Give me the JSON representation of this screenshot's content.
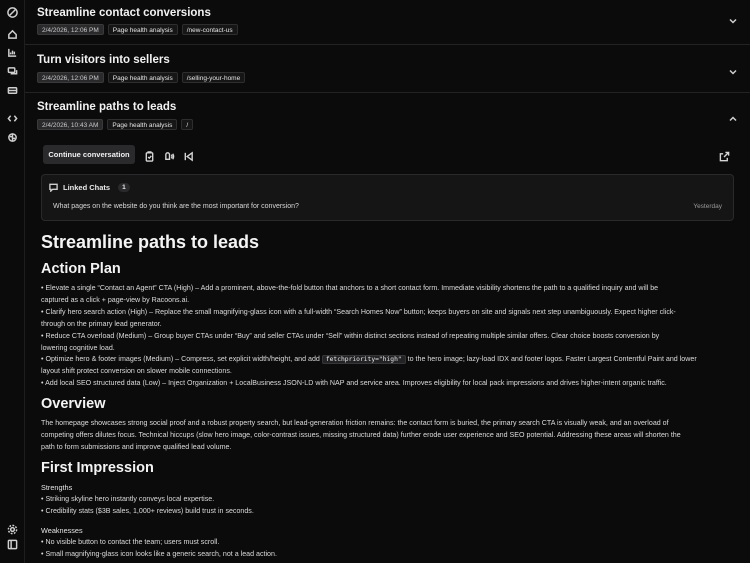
{
  "sidebar": {
    "icons": [
      "logo-icon",
      "home-icon",
      "chart-icon",
      "chat-icon",
      "inbox-icon",
      "code-icon",
      "brain-icon",
      "settings-icon",
      "panel-icon"
    ]
  },
  "items": [
    {
      "title": "Streamline contact conversions",
      "date": "2/4/2026, 12:06 PM",
      "tag": "Page health analysis",
      "path": "/new-contact-us",
      "expanded": false
    },
    {
      "title": "Turn visitors into sellers",
      "date": "2/4/2026, 12:06 PM",
      "tag": "Page health analysis",
      "path": "/selling-your-home",
      "expanded": false
    },
    {
      "title": "Streamline paths to leads",
      "date": "2/4/2026, 10:43 AM",
      "tag": "Page health analysis",
      "path": "/",
      "expanded": true
    }
  ],
  "actions": {
    "continue_label": "Continue conversation"
  },
  "linked_chats": {
    "label": "Linked Chats",
    "count": "1",
    "question": "What pages on the website do you think are the most important for conversion?",
    "time": "Yesterday"
  },
  "report": {
    "title": "Streamline paths to leads",
    "action_plan_heading": "Action Plan",
    "action_plan": [
      "• Elevate a single “Contact an Agent” CTA (High) – Add a prominent, above-the-fold button that anchors to a short contact form. Immediate visibility shortens the path to a qualified inquiry and will be",
      "captured as a click + page-view by Racoons.ai.",
      "• Clarify hero search action (High) – Replace the small magnifying-glass icon with a full-width “Search Homes Now” button; keeps buyers on site and signals next step unambiguously. Expect higher click-",
      "through on the primary lead generator.",
      "• Reduce CTA overload (Medium) – Group buyer CTAs under “Buy” and seller CTAs under “Sell” within distinct sections instead of repeating multiple similar offers. Clear choice boosts conversion by",
      "lowering cognitive load."
    ],
    "optimize_before": "• Optimize hero & footer images (Medium) – Compress, set explicit width/height, and add ",
    "optimize_code": "fetchpriority=\"high\"",
    "optimize_after": " to the hero image; lazy-load IDX and footer logos. Faster Largest Contentful Paint and lower",
    "action_plan_tail": [
      "layout shift protect conversion on slower mobile connections.",
      "• Add local SEO structured data (Low) – Inject Organization + LocalBusiness JSON-LD with NAP and service area. Improves eligibility for local pack impressions and drives higher-intent organic traffic."
    ],
    "overview_heading": "Overview",
    "overview": [
      "The homepage showcases strong social proof and a robust property search, but lead-generation friction remains: the contact form is buried, the primary search CTA is visually weak, and an overload of",
      "competing offers dilutes focus. Technical hiccups (slow hero image, color-contrast issues, missing structured data) further erode user experience and SEO potential. Addressing these areas will shorten the",
      "path to form submissions and improve qualified lead volume."
    ],
    "first_impression_heading": "First Impression",
    "strengths_label": "Strengths",
    "strengths": [
      "• Striking skyline hero instantly conveys local expertise.",
      "• Credibility stats ($3B sales, 1,000+ reviews) build trust in seconds."
    ],
    "weaknesses_label": "Weaknesses",
    "weaknesses": [
      "• No visible button to contact the team; users must scroll.",
      "• Small magnifying-glass icon looks like a generic search, not a lead action."
    ]
  }
}
